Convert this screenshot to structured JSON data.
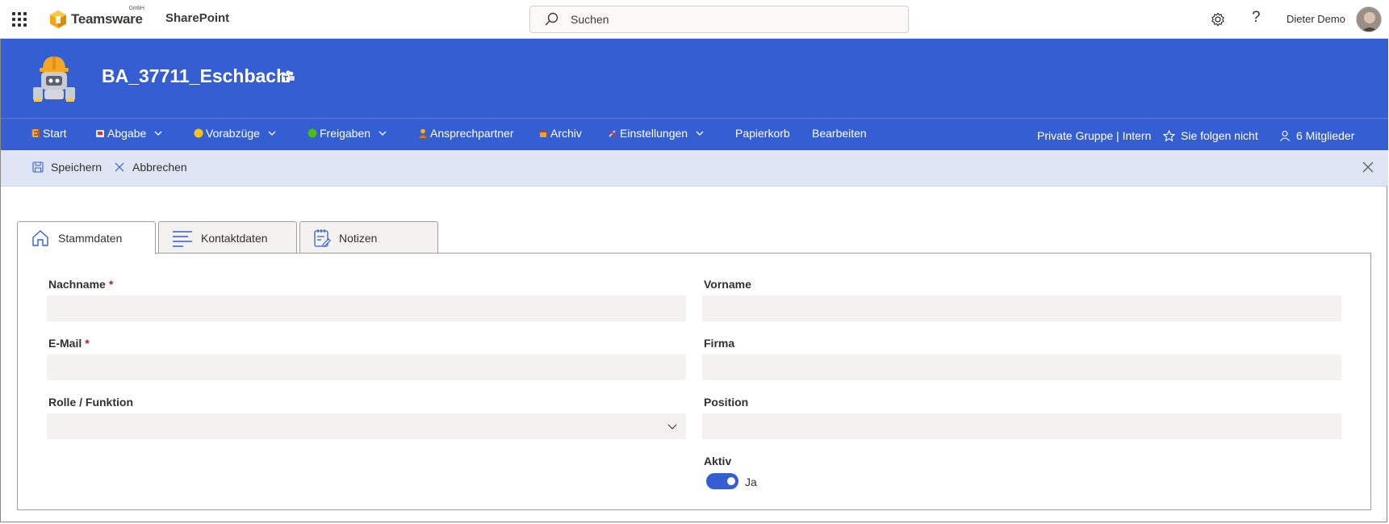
{
  "suite": {
    "brand": "Teamsware",
    "brand_suffix": "GmbH",
    "app_name": "SharePoint",
    "search_placeholder": "Suchen",
    "user_name": "Dieter Demo"
  },
  "site": {
    "title": "BA_37711_Eschbach"
  },
  "nav": {
    "items": [
      {
        "label": "Start"
      },
      {
        "label": "Abgabe"
      },
      {
        "label": "Vorabzüge"
      },
      {
        "label": "Freigaben"
      },
      {
        "label": "Ansprechpartner"
      },
      {
        "label": "Archiv"
      },
      {
        "label": "Einstellungen"
      },
      {
        "label": "Papierkorb"
      },
      {
        "label": "Bearbeiten"
      }
    ],
    "group_info": "Private Gruppe | Intern",
    "follow": "Sie folgen nicht",
    "members": "6 Mitglieder"
  },
  "commands": {
    "save": "Speichern",
    "cancel": "Abbrechen"
  },
  "tabs": [
    {
      "label": "Stammdaten"
    },
    {
      "label": "Kontaktdaten"
    },
    {
      "label": "Notizen"
    }
  ],
  "form": {
    "nachname_label": "Nachname",
    "vorname_label": "Vorname",
    "email_label": "E-Mail",
    "firma_label": "Firma",
    "rolle_label": "Rolle / Funktion",
    "position_label": "Position",
    "aktiv_label": "Aktiv",
    "aktiv_value": "Ja",
    "required_marker": "*"
  },
  "colors": {
    "brand_blue": "#345ed2",
    "command_bar": "#dfe5f5",
    "required": "#a4262c"
  }
}
